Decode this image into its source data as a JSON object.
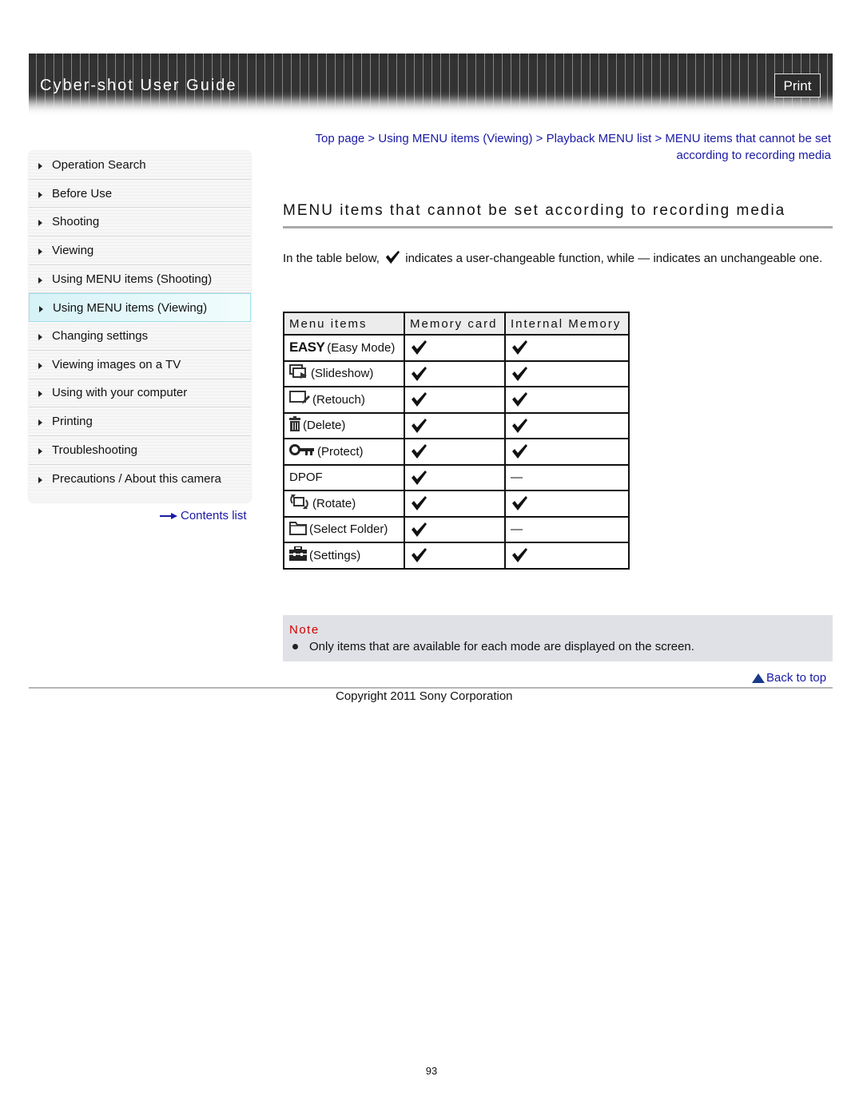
{
  "header": {
    "title": "Cyber-shot User Guide",
    "print_label": "Print"
  },
  "sidebar": {
    "items": [
      {
        "label": "Operation Search",
        "active": false
      },
      {
        "label": "Before Use",
        "active": false
      },
      {
        "label": "Shooting",
        "active": false
      },
      {
        "label": "Viewing",
        "active": false
      },
      {
        "label": "Using MENU items (Shooting)",
        "active": false
      },
      {
        "label": "Using MENU items (Viewing)",
        "active": true
      },
      {
        "label": "Changing settings",
        "active": false
      },
      {
        "label": "Viewing images on a TV",
        "active": false
      },
      {
        "label": "Using with your computer",
        "active": false
      },
      {
        "label": "Printing",
        "active": false
      },
      {
        "label": "Troubleshooting",
        "active": false
      },
      {
        "label": "Precautions / About this camera",
        "active": false
      }
    ],
    "contents_link": "Contents list"
  },
  "breadcrumb": {
    "items": [
      "Top page",
      "Using MENU items (Viewing)",
      "Playback MENU list",
      "MENU items that cannot be set according to recording media"
    ],
    "separator": " > "
  },
  "page": {
    "title": "MENU items that cannot be set according to recording media",
    "intro_before": "In the table below, ",
    "intro_after": " indicates a user-changeable function, while — indicates an unchangeable one."
  },
  "table": {
    "headers": [
      "Menu items",
      "Memory card",
      "Internal Memory"
    ],
    "rows": [
      {
        "icon": "easy-mode-icon",
        "icon_text": "EASY",
        "label": "(Easy Mode)",
        "memory_card": "check",
        "internal_memory": "check"
      },
      {
        "icon": "slideshow-icon",
        "label": "(Slideshow)",
        "memory_card": "check",
        "internal_memory": "check"
      },
      {
        "icon": "retouch-icon",
        "label": "(Retouch)",
        "memory_card": "check",
        "internal_memory": "check"
      },
      {
        "icon": "delete-icon",
        "label": "(Delete)",
        "memory_card": "check",
        "internal_memory": "check"
      },
      {
        "icon": "protect-key-icon",
        "label": "(Protect)",
        "memory_card": "check",
        "internal_memory": "check"
      },
      {
        "icon": "",
        "label": "DPOF",
        "memory_card": "check",
        "internal_memory": "—"
      },
      {
        "icon": "rotate-icon",
        "label": "(Rotate)",
        "memory_card": "check",
        "internal_memory": "check"
      },
      {
        "icon": "folder-icon",
        "label": "(Select Folder)",
        "memory_card": "check",
        "internal_memory": "—"
      },
      {
        "icon": "settings-toolbox-icon",
        "label": "(Settings)",
        "memory_card": "check",
        "internal_memory": "check"
      }
    ]
  },
  "note": {
    "title": "Note",
    "text": "Only items that are available for each mode are displayed on the screen."
  },
  "footer": {
    "back_to_top": "Back to top",
    "copyright": "Copyright 2011 Sony Corporation",
    "page_number": "93"
  },
  "colors": {
    "link": "#1a1aa6",
    "note_title": "#d40000",
    "note_bg": "#dfe1e6",
    "active_nav": "#d6f2f7"
  }
}
